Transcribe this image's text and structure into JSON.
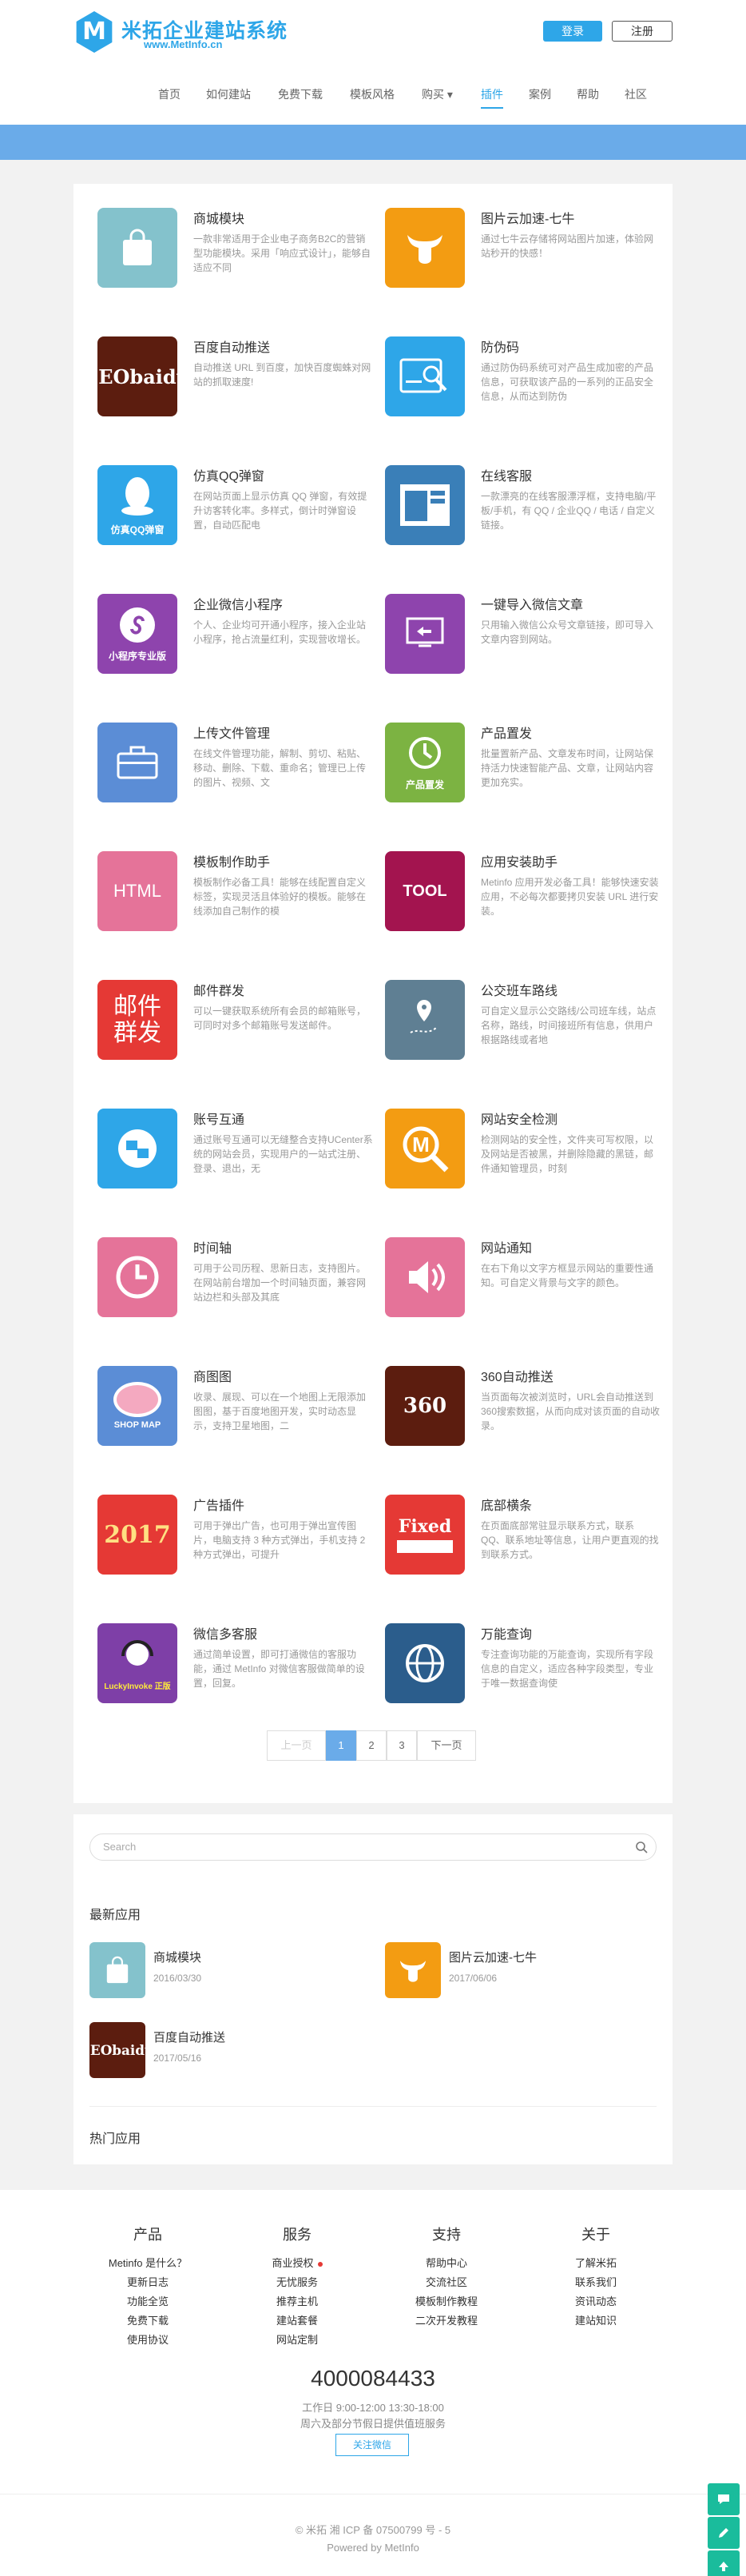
{
  "header": {
    "logo_letter": "M",
    "logo_title": "米拓企业建站系统",
    "logo_url": "www.MetInfo.cn",
    "login": "登录",
    "register": "注册"
  },
  "nav": [
    "首页",
    "如何建站",
    "免费下载",
    "模板风格",
    "购买 ▾",
    "插件",
    "案例",
    "帮助",
    "社区"
  ],
  "apps": [
    {
      "title": "商城模块",
      "desc": "一款非常适用于企业电子商务B2C的营销型功能模块。采用「响应式设计」，能够自适应不同",
      "icon": "bag-icon",
      "color": "#84c2cc",
      "label": ""
    },
    {
      "title": "图片云加速-七牛",
      "desc": "通过七牛云存储将网站图片加速，体验网站秒开的快感！",
      "icon": "qiniu-icon",
      "color": "#f39c12",
      "label": ""
    },
    {
      "title": "百度自动推送",
      "desc": "自动推送 URL 到百度，加快百度蜘蛛对网站的抓取速度!",
      "icon": "seo-icon",
      "color": "#5c1d0f",
      "label": "SEObaidu"
    },
    {
      "title": "防伪码",
      "desc": "通过防伪码系统可对产品生成加密的产品信息，可获取该产品的一系列的正品安全信息，从而达到防伪",
      "icon": "search-card-icon",
      "color": "#2ea6e8",
      "label": ""
    },
    {
      "title": "仿真QQ弹窗",
      "desc": "在网站页面上显示仿真 QQ 弹窗，有效提升访客转化率。多样式，倒计时弹窗设置，自动匹配电",
      "icon": "qq-icon",
      "color": "#2ea6e8",
      "label": "仿真QQ弹窗"
    },
    {
      "title": "在线客服",
      "desc": "一款漂亮的在线客服漂浮框，支持电脑/平板/手机，有 QQ / 企业QQ / 电话 / 自定义链接。",
      "icon": "chat-window-icon",
      "color": "#3a7fb8",
      "label": ""
    },
    {
      "title": "企业微信小程序",
      "desc": "个人、企业均可开通小程序，接入企业站小程序，抢占流量红利，实现营收增长。",
      "icon": "mini-program-icon",
      "color": "#8e44ad",
      "label": "小程序专业版"
    },
    {
      "title": "一键导入微信文章",
      "desc": "只用输入微信公众号文章链接，即可导入文章内容到网站。",
      "icon": "import-icon",
      "color": "#8e44ad",
      "label": ""
    },
    {
      "title": "上传文件管理",
      "desc": "在线文件管理功能，解制、剪切、粘贴、移动、删除、下载、重命名；管理已上传的图片、视频、文",
      "icon": "briefcase-icon",
      "color": "#5b8dd6",
      "label": ""
    },
    {
      "title": "产品置发",
      "desc": "批量置新产品、文章发布时间，让网站保持活力快速智能产品、文章，让网站内容更加充实。",
      "icon": "clock-arrow-icon",
      "color": "#7cb342",
      "label": "产品置发"
    },
    {
      "title": "模板制作助手",
      "desc": "模板制作必备工具！能够在线配置自定义标签，实现灵活且体验好的模板。能够在线添加自己制作的模",
      "icon": "html-icon",
      "color": "#e57399",
      "label": "HTML"
    },
    {
      "title": "应用安装助手",
      "desc": "Metinfo 应用开发必备工具！能够快速安装应用，不必每次都要拷贝安装 URL 进行安装。",
      "icon": "tool-icon",
      "color": "#a3144f",
      "label": "TOOL"
    },
    {
      "title": "邮件群发",
      "desc": "可以一键获取系统所有会员的邮箱账号，可同时对多个邮箱账号发送邮件。",
      "icon": "mail-icon",
      "color": "#e53935",
      "label": "邮件群发"
    },
    {
      "title": "公交班车路线",
      "desc": "可自定义显示公交路线/公司班车线，站点名称，路线，时间接班所有信息，供用户根据路线或者地",
      "icon": "map-pin-icon",
      "color": "#5f7f93",
      "label": ""
    },
    {
      "title": "账号互通",
      "desc": "通过账号互通可以无缝整合支持UCenter系统的网站会员，实现用户的一站式注册、登录、退出，无",
      "icon": "sync-icon",
      "color": "#2ea6e8",
      "label": ""
    },
    {
      "title": "网站安全检测",
      "desc": "检测网站的安全性，文件夹可写权限，以及网站是否被黑，并删除隐藏的黑链，邮件通知管理员，时刻",
      "icon": "magnifier-icon",
      "color": "#f39c12",
      "label": "M"
    },
    {
      "title": "时间轴",
      "desc": "可用于公司历程、思新日志，支持图片。在网站前台增加一个时间轴页面，兼容网站边栏和头部及其底",
      "icon": "clock-icon",
      "color": "#e57399",
      "label": ""
    },
    {
      "title": "网站通知",
      "desc": "在右下角以文字方框显示网站的重要性通知。可自定义背景与文字的颜色。",
      "icon": "speaker-icon",
      "color": "#e57399",
      "label": ""
    },
    {
      "title": "商图图",
      "desc": "收录、展现、可以在一个地图上无限添加图图，基于百度地图开发，实时动态显示，支持卫星地图，二",
      "icon": "shop-map-icon",
      "color": "#5b8dd6",
      "label": "SHOP MAP"
    },
    {
      "title": "360自动推送",
      "desc": "当页面每次被浏览时，URL会自动推送到360搜索数据，从而向成对该页面的自动收录。",
      "icon": "seo360-icon",
      "color": "#5c1d0f",
      "label": "360"
    },
    {
      "title": "广告插件",
      "desc": "可用于弹出广告，也可用于弹出宣传图片，电脑支持 3 种方式弹出，手机支持 2 种方式弹出，可提升",
      "icon": "ad-2017-icon",
      "color": "#e53935",
      "label": "2017"
    },
    {
      "title": "底部横条",
      "desc": "在页面底部常驻显示联系方式，联系 QQ、联系地址等信息，让用户更直观的找到联系方式。",
      "icon": "fixed-bar-icon",
      "color": "#e53935",
      "label": "Fixed"
    },
    {
      "title": "微信多客服",
      "desc": "通过简单设置，即可打通微信的客服功能，通过 MetInfo 对微信客服做简单的设置，回复。",
      "icon": "headset-icon",
      "color": "#7e3fa7",
      "label": "LuckyInvoke 正版"
    },
    {
      "title": "万能查询",
      "desc": "专注查询功能的万能查询，实现所有字段信息的自定义，适应各种字段类型，专业于唯一数据查询使",
      "icon": "globe-icon",
      "color": "#2b5d8c",
      "label": ""
    }
  ],
  "pagination": {
    "prev": "上一页",
    "pages": [
      "1",
      "2",
      "3"
    ],
    "next": "下一页"
  },
  "sidebar": {
    "search_placeholder": "Search",
    "latest_title": "最新应用",
    "latest": [
      {
        "title": "商城模块",
        "date": "2016/03/30",
        "icon": "bag-icon",
        "color": "#84c2cc",
        "label": ""
      },
      {
        "title": "图片云加速-七牛",
        "date": "2017/06/06",
        "icon": "qiniu-icon",
        "color": "#f39c12",
        "label": ""
      },
      {
        "title": "百度自动推送",
        "date": "2017/05/16",
        "icon": "seo-icon",
        "color": "#5c1d0f",
        "label": "SEObaidu"
      }
    ],
    "hot_title": "热门应用"
  },
  "footer": {
    "cols": [
      {
        "title": "产品",
        "links": [
          "Metinfo 是什么？",
          "更新日志",
          "功能全览",
          "免费下载",
          "使用协议"
        ]
      },
      {
        "title": "服务",
        "links": [
          "商业授权",
          "无忧服务",
          "推荐主机",
          "建站套餐",
          "网站定制"
        ]
      },
      {
        "title": "支持",
        "links": [
          "帮助中心",
          "交流社区",
          "模板制作教程",
          "二次开发教程"
        ]
      },
      {
        "title": "关于",
        "links": [
          "了解米拓",
          "联系我们",
          "资讯动态",
          "建站知识"
        ]
      }
    ],
    "phone": "4000084433",
    "hours1": "工作日 9:00-12:00 13:30-18:00",
    "hours2": "周六及部分节假日提供值班服务",
    "follow": "关注微信",
    "icp": "© 米拓 湘 ICP 备 07500799 号 - 5",
    "powered": "Powered by MetInfo"
  },
  "colors": {
    "accent": "#2ea6e8",
    "banner": "#6aabe9"
  }
}
